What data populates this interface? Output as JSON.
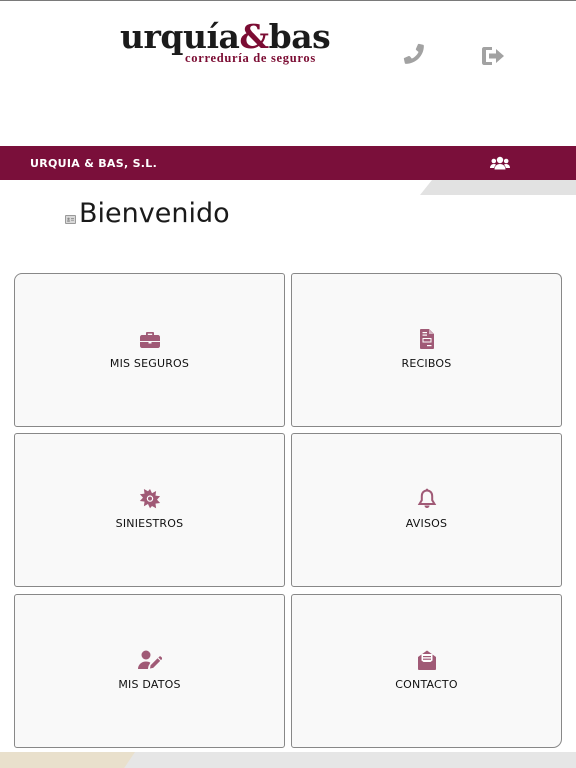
{
  "brand": {
    "name_part1": "urquía",
    "name_amp": "&",
    "name_part2": "bas",
    "tagline": "correduría de seguros"
  },
  "header": {
    "phone_icon": "phone-icon",
    "logout_icon": "sign-out-icon"
  },
  "company_bar": {
    "name": "URQUIA & BAS, S.L.",
    "users_icon": "users-icon"
  },
  "welcome": {
    "title": "Bienvenido",
    "icon": "id-card-icon"
  },
  "tiles": [
    {
      "label": "MIS SEGUROS",
      "icon": "briefcase-icon"
    },
    {
      "label": "RECIBOS",
      "icon": "invoice-icon"
    },
    {
      "label": "SINIESTROS",
      "icon": "burst-icon"
    },
    {
      "label": "AVISOS",
      "icon": "bell-icon"
    },
    {
      "label": "MIS DATOS",
      "icon": "user-edit-icon"
    },
    {
      "label": "CONTACTO",
      "icon": "envelope-open-icon"
    }
  ],
  "colors": {
    "brand_maroon": "#7a0f3a",
    "icon_mauve": "#a05a76",
    "header_icon_gray": "#a2a2a2",
    "tile_bg": "#f9f9f9"
  }
}
